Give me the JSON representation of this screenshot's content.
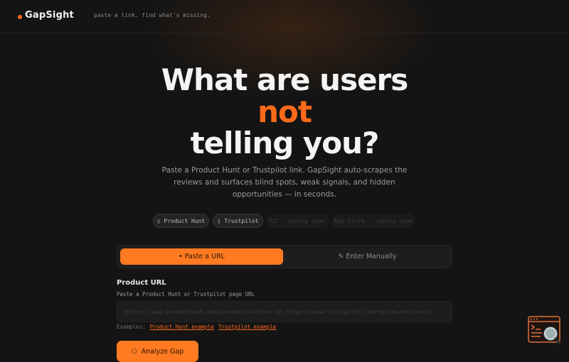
{
  "header": {
    "logo": "GapSight",
    "tagline": "paste a link. find what's missing."
  },
  "hero": {
    "line1": "What are users",
    "line2": "not",
    "line3": "telling you?",
    "subtitle": "Paste a Product Hunt or Trustpilot link. GapSight auto-scrapes the reviews and surfaces blind spots, weak signals, and hidden opportunities — in seconds."
  },
  "sources": [
    {
      "label": "Product Hunt",
      "status": "active"
    },
    {
      "label": "Trustpilot",
      "status": "active"
    },
    {
      "label": "G2 · coming soon",
      "status": "soon"
    },
    {
      "label": "App Store · coming soon",
      "status": "soon"
    }
  ],
  "mode": {
    "paste_label": "• Paste a URL",
    "manual_label": "✎ Enter Manually",
    "selected": "paste"
  },
  "form": {
    "label": "Product URL",
    "hint": "Paste a Product Hunt or Trustpilot page URL",
    "placeholder": "https://www.producthunt.com/products/notion or https://www.trustpilot.com/review/notion.so",
    "value": "",
    "examples_label": "Examples:",
    "example1": "Product Hunt example",
    "example2": "Trustpilot example"
  },
  "submit": {
    "label": "Analyze Gap"
  },
  "colors": {
    "accent": "#ff7a21",
    "background": "#141414"
  }
}
